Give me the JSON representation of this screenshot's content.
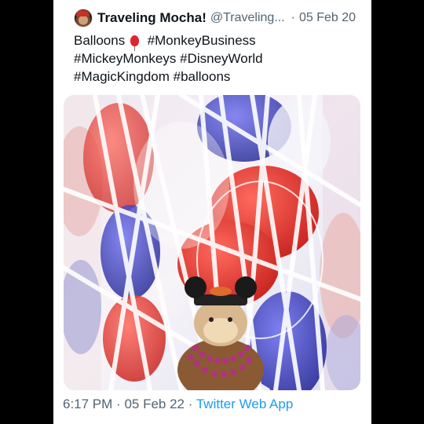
{
  "tweet": {
    "author_name": "Traveling Mocha!",
    "handle": "@Traveling...",
    "separator": "·",
    "date": "05 Feb 20",
    "text_line1_word": "Balloons",
    "hashtags": [
      "#MonkeyBusiness",
      "#MickeyMonkeys",
      "#DisneyWorld",
      "#MagicKingdom",
      "#balloons"
    ],
    "emoji": "balloon-icon",
    "media_alt_icon": "photo-icon",
    "footer": {
      "time": "6:17 PM",
      "dot1": "·",
      "date": "05 Feb 22",
      "dot2": "·",
      "source": "Twitter Web App"
    }
  },
  "colors": {
    "background": "#000000",
    "card": "#ffffff",
    "text": "#0f1419",
    "secondary": "#536471",
    "link": "#1d9bf0"
  }
}
